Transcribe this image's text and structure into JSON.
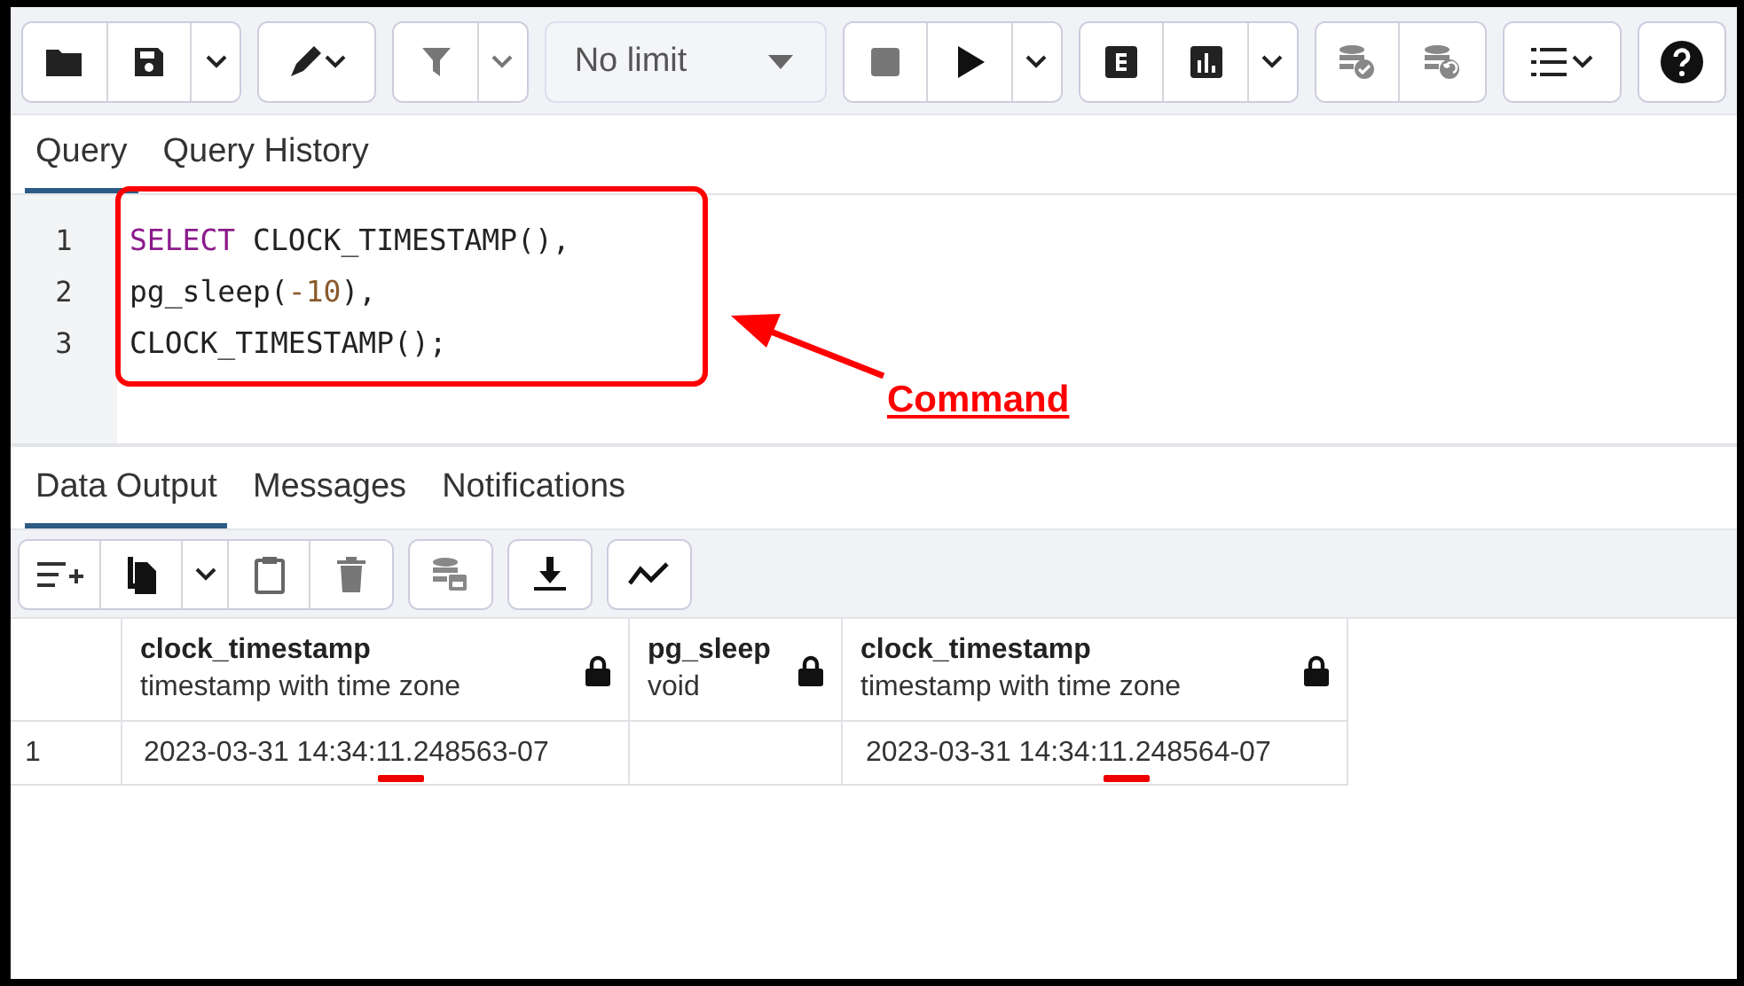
{
  "toolbar": {
    "limit_select": "No limit"
  },
  "editor_tabs": [
    {
      "label": "Query",
      "selected": true
    },
    {
      "label": "Query History",
      "selected": false
    }
  ],
  "code_lines": [
    {
      "number": "1",
      "tokens": [
        {
          "kind": "keyword",
          "text": "SELECT"
        },
        {
          "kind": "plain",
          "text": " CLOCK_TIMESTAMP(),"
        }
      ]
    },
    {
      "number": "2",
      "tokens": [
        {
          "kind": "plain",
          "text": "pg_sleep("
        },
        {
          "kind": "number",
          "text": "-10"
        },
        {
          "kind": "plain",
          "text": "),"
        }
      ]
    },
    {
      "number": "3",
      "tokens": [
        {
          "kind": "plain",
          "text": "CLOCK_TIMESTAMP();"
        }
      ]
    }
  ],
  "annotation": {
    "label": "Command"
  },
  "result_tabs": [
    {
      "label": "Data Output",
      "selected": true
    },
    {
      "label": "Messages",
      "selected": false
    },
    {
      "label": "Notifications",
      "selected": false
    }
  ],
  "table": {
    "columns": [
      {
        "name": "clock_timestamp",
        "type": "timestamp with time zone",
        "locked": true
      },
      {
        "name": "pg_sleep",
        "type": "void",
        "locked": true
      },
      {
        "name": "clock_timestamp",
        "type": "timestamp with time zone",
        "locked": true
      }
    ],
    "rows": [
      {
        "number": "1",
        "cells": [
          "2023-03-31 14:34:11.248563-07",
          "",
          "2023-03-31 14:34:11.248564-07"
        ]
      }
    ]
  }
}
